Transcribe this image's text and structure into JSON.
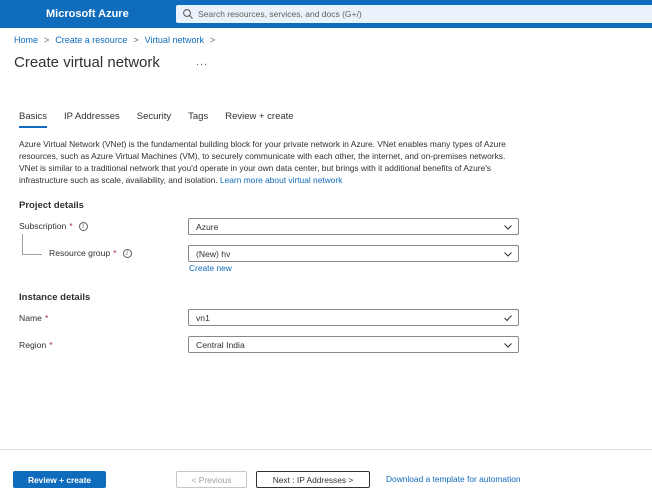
{
  "header": {
    "brand": "Microsoft Azure",
    "search_placeholder": "Search resources, services, and docs (G+/)",
    "search_icon": "search-icon"
  },
  "breadcrumb": {
    "items": [
      "Home",
      "Create a resource",
      "Virtual network"
    ],
    "separator": ">"
  },
  "page": {
    "title": "Create virtual network",
    "more": "..."
  },
  "tabs": [
    {
      "label": "Basics",
      "active": true
    },
    {
      "label": "IP Addresses",
      "active": false
    },
    {
      "label": "Security",
      "active": false
    },
    {
      "label": "Tags",
      "active": false
    },
    {
      "label": "Review + create",
      "active": false
    }
  ],
  "description": {
    "text": "Azure Virtual Network (VNet) is the fundamental building block for your private network in Azure. VNet enables many types of Azure resources, such as Azure Virtual Machines (VM), to securely communicate with each other, the internet, and on-premises networks. VNet is similar to a traditional network that you'd operate in your own data center, but brings with it additional benefits of Azure's infrastructure such as scale, availability, and isolation.",
    "link": "Learn more about virtual network"
  },
  "project_details": {
    "title": "Project details",
    "subscription_label": "Subscription",
    "subscription_value": "Azure",
    "resource_group_label": "Resource group",
    "resource_group_value": "(New) hv",
    "create_new": "Create new",
    "required_mark": "*",
    "info_mark": "i"
  },
  "instance_details": {
    "title": "Instance details",
    "name_label": "Name",
    "name_value": "vn1",
    "region_label": "Region",
    "region_value": "Central India",
    "required_mark": "*"
  },
  "footer": {
    "review_create": "Review + create",
    "previous": "< Previous",
    "next": "Next : IP Addresses >",
    "download": "Download a template for automation"
  },
  "colors": {
    "accent": "#0f6cbd",
    "required": "#a4262c"
  }
}
